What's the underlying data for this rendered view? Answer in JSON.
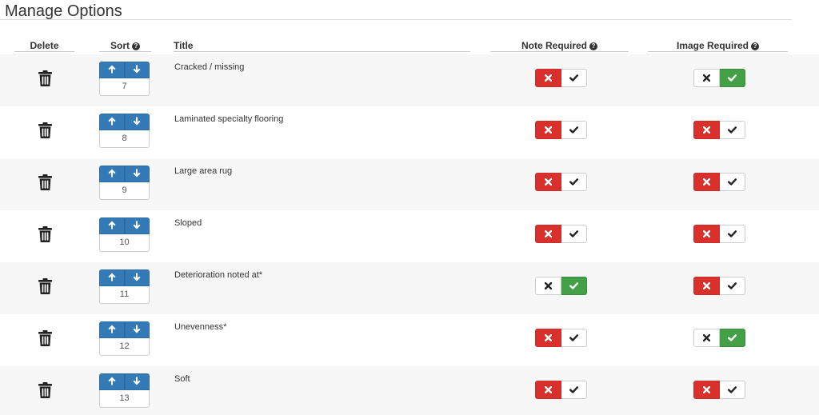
{
  "page": {
    "title": "Manage Options"
  },
  "columns": {
    "delete": "Delete",
    "sort": "Sort",
    "title": "Title",
    "note_required": "Note Required",
    "image_required": "Image Required",
    "help_glyph": "?"
  },
  "colors": {
    "primary": "#337ab7",
    "danger": "#d9302c",
    "success": "#43a047",
    "row_stripe": "#f7f7f7"
  },
  "icons": {
    "delete": "trash-icon",
    "sort_up": "arrow-up-icon",
    "sort_down": "arrow-down-icon",
    "no": "x-icon",
    "yes": "check-icon",
    "help": "question-circle-icon"
  },
  "rows": [
    {
      "sort": "7",
      "title": "Cracked / missing",
      "note_required": false,
      "image_required": true
    },
    {
      "sort": "8",
      "title": "Laminated specialty flooring",
      "note_required": false,
      "image_required": false
    },
    {
      "sort": "9",
      "title": "Large area rug",
      "note_required": false,
      "image_required": false
    },
    {
      "sort": "10",
      "title": "Sloped",
      "note_required": false,
      "image_required": false
    },
    {
      "sort": "11",
      "title": "Deterioration noted at*",
      "note_required": true,
      "image_required": false
    },
    {
      "sort": "12",
      "title": "Unevenness*",
      "note_required": false,
      "image_required": true
    },
    {
      "sort": "13",
      "title": "Soft",
      "note_required": false,
      "image_required": false
    }
  ]
}
